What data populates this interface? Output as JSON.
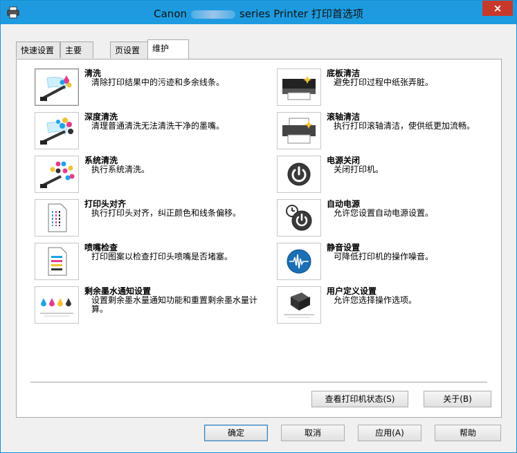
{
  "window": {
    "title_prefix": "Canon",
    "title_suffix": "series Printer 打印首选项",
    "close_label": "×"
  },
  "tabs": [
    {
      "label": "快速设置",
      "active": false
    },
    {
      "label": "主要",
      "active": false
    },
    {
      "label": "页设置",
      "active": false
    },
    {
      "label": "维护",
      "active": true
    }
  ],
  "left_items": [
    {
      "name": "清洗",
      "desc": "清除打印结果中的污迹和多余线条。",
      "icon": "cleaning-icon"
    },
    {
      "name": "深度清洗",
      "desc": "清理普通清洗无法清洗干净的墨嘴。",
      "icon": "deep-cleaning-icon"
    },
    {
      "name": "系统清洗",
      "desc": "执行系统清洗。",
      "icon": "system-cleaning-icon"
    },
    {
      "name": "打印头对齐",
      "desc": "执行打印头对齐，纠正颜色和线条偏移。",
      "icon": "print-head-alignment-icon"
    },
    {
      "name": "喷嘴检查",
      "desc": "打印图案以检查打印头喷嘴是否堵塞。",
      "icon": "nozzle-check-icon"
    },
    {
      "name": "剩余墨水通知设置",
      "desc": "设置剩余墨水量通知功能和重置剩余墨水量计算。",
      "icon": "ink-notification-icon"
    }
  ],
  "right_items": [
    {
      "name": "底板清洁",
      "desc": "避免打印过程中纸张弄脏。",
      "icon": "bottom-plate-cleaning-icon"
    },
    {
      "name": "滚轴清洁",
      "desc": "执行打印滚轴清洁，使供纸更加流畅。",
      "icon": "roller-cleaning-icon"
    },
    {
      "name": "电源关闭",
      "desc": "关闭打印机。",
      "icon": "power-off-icon"
    },
    {
      "name": "自动电源",
      "desc": "允许您设置自动电源设置。",
      "icon": "auto-power-icon"
    },
    {
      "name": "静音设置",
      "desc": "可降低打印机的操作噪音。",
      "icon": "quiet-settings-icon"
    },
    {
      "name": "用户定义设置",
      "desc": "允许您选择操作选项。",
      "icon": "custom-settings-icon"
    }
  ],
  "panel_buttons": {
    "printer_status": "查看打印机状态(S)",
    "about": "关于(B)"
  },
  "footer_buttons": {
    "ok": "确定",
    "cancel": "取消",
    "apply": "应用(A)",
    "help": "帮助"
  },
  "colors": {
    "titlebar": "#1e9be0",
    "close": "#c7392b"
  }
}
